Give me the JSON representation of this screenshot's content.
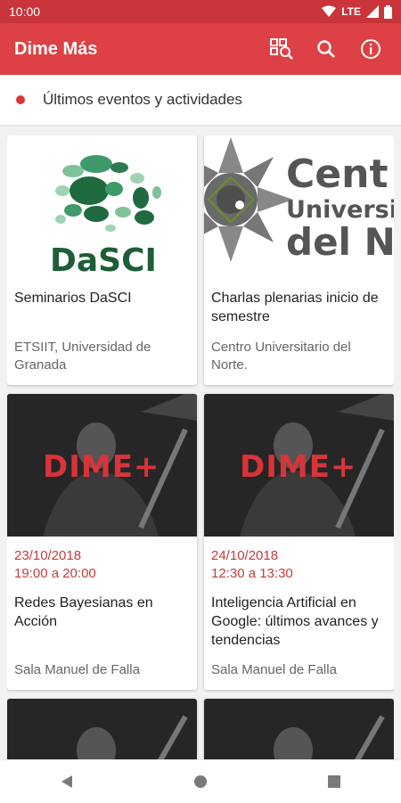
{
  "status_bar": {
    "time": "10:00",
    "network": "LTE"
  },
  "app_bar": {
    "title": "Dime Más",
    "actions": [
      "qr-scan-icon",
      "search-icon",
      "info-icon"
    ]
  },
  "section": {
    "title": "Últimos eventos y actividades"
  },
  "colors": {
    "primary": "#dd4145",
    "status": "#c9353a",
    "accent": "#d9343a",
    "date": "#c63b3b"
  },
  "cards": [
    {
      "image": "DaSCI",
      "title": "Seminarios DaSCI",
      "date_line1": "",
      "date_line2": "",
      "place": "ETSIIT, Universidad de Granada"
    },
    {
      "image": "Centro Universitario del Norte logo",
      "image_text_1": "Cent",
      "image_text_2": "Universit",
      "image_text_3": "del No",
      "title": "Charlas plenarias inicio de semestre",
      "date_line1": "",
      "date_line2": "",
      "place": "Centro Universitario del Norte."
    },
    {
      "image": "DIME+",
      "title": "Redes Bayesianas en Acción",
      "date_line1": "23/10/2018",
      "date_line2": "19:00 a 20:00",
      "place": "Sala Manuel de Falla"
    },
    {
      "image": "DIME+",
      "title": "Inteligencia Artificial en Google: últimos avances y tendencias",
      "date_line1": "24/10/2018",
      "date_line2": "12:30 a 13:30",
      "place": "Sala Manuel de Falla"
    }
  ],
  "dime_logo_text": "DIME+",
  "nav": [
    "back-icon",
    "home-icon",
    "recents-icon"
  ]
}
